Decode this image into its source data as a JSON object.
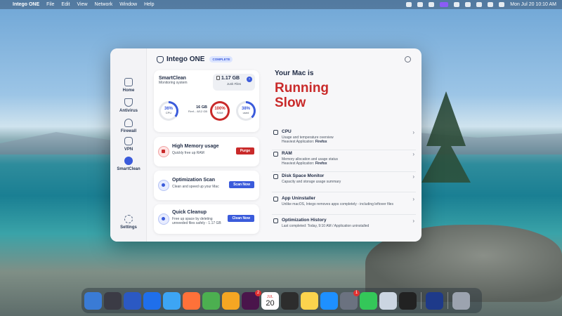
{
  "menubar": {
    "app_name": "Intego ONE",
    "menus": [
      "File",
      "Edit",
      "View",
      "Network",
      "Window",
      "Help"
    ],
    "datetime": "Mon Jul 20  10:10 AM"
  },
  "app": {
    "logo_text": "Intego ONE",
    "badge": "COMPLETE"
  },
  "sidebar": {
    "items": [
      {
        "label": "Home",
        "icon": "home-icon"
      },
      {
        "label": "Antivirus",
        "icon": "shield-icon"
      },
      {
        "label": "Firewall",
        "icon": "firewall-icon"
      },
      {
        "label": "VPN",
        "icon": "vpn-icon"
      },
      {
        "label": "SmartClean",
        "icon": "smartclean-icon"
      },
      {
        "label": "Settings",
        "icon": "gear-icon"
      }
    ],
    "active": "SmartClean"
  },
  "smartclean": {
    "title": "SmartClean",
    "subtitle": "Monitoring system",
    "junk_size": "1.17 GB",
    "junk_label": "Junk Files",
    "cpu_value": "36%",
    "cpu_label": "CPU",
    "cpu_fraction": 0.36,
    "ram_total": "16 GB",
    "ram_detail": "Firef... 8/12 GB",
    "ram_value": "100%",
    "ram_label": "RAM",
    "used_value": "38%",
    "used_label": "used",
    "used_fraction": 0.38
  },
  "tasks": [
    {
      "title": "High Memory usage",
      "subtitle": "Quickly free up RAM",
      "button": "Purge"
    },
    {
      "title": "Optimization Scan",
      "subtitle": "Clean and speed up your Mac",
      "button": "Scan Now"
    },
    {
      "title": "Quick Cleanup",
      "subtitle": "Free up space by deleting unneeded files safely - 1.17 GB",
      "button": "Clean Now"
    }
  ],
  "status": {
    "title": "Your Mac is",
    "line1": "Running",
    "line2": "Slow"
  },
  "list": [
    {
      "title": "CPU",
      "sub1": "Usage and temperature overview",
      "sub2_label": "Heaviest Application:",
      "sub2_value": "Firefox"
    },
    {
      "title": "RAM",
      "sub1": "Memory allocation and usage status",
      "sub2_label": "Heaviest Application:",
      "sub2_value": "Firefox"
    },
    {
      "title": "Disk Space Monitor",
      "sub1": "Capacity and storage usage summary"
    },
    {
      "title": "App Uninstaller",
      "sub1": "Unlike macOS, Intego removes apps completely - including leftover files"
    },
    {
      "title": "Optimization History",
      "sub1": "Last completed: Today, 9:10 AM / Application uninstalled"
    }
  ],
  "dock": {
    "calendar_month": "JUL",
    "calendar_day": "20",
    "badge_slack": "2",
    "badge_settings": "1"
  },
  "colors": {
    "accent": "#3b5bdb",
    "danger": "#c92a2a"
  }
}
